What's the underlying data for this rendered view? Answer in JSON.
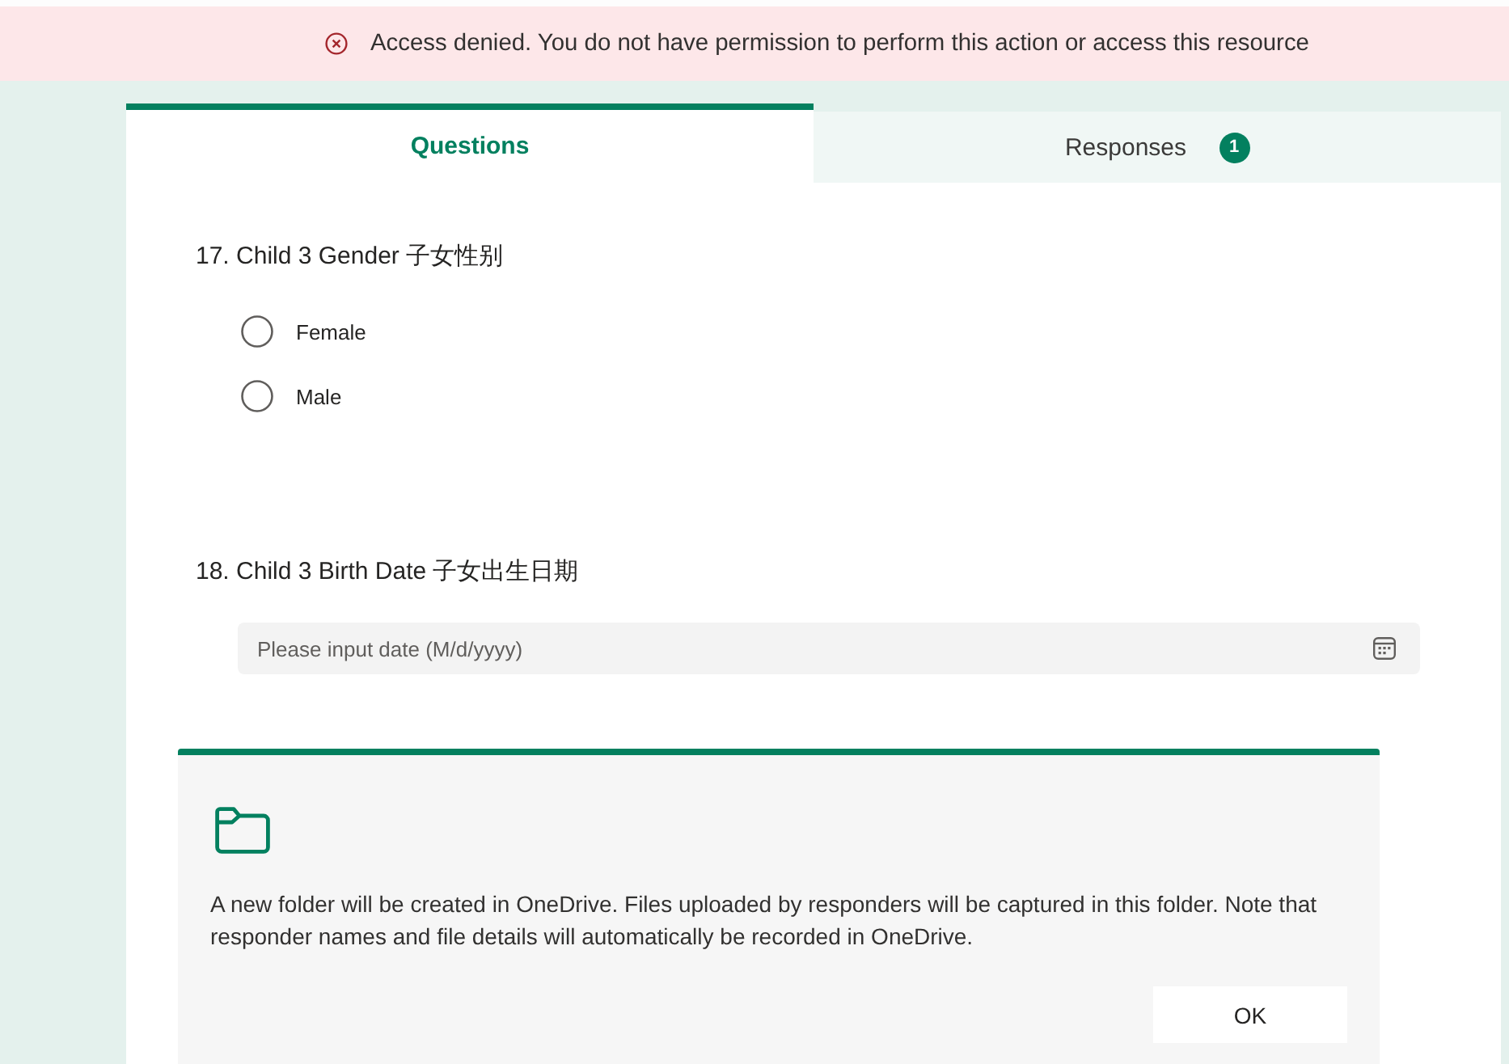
{
  "banner": {
    "message": "Access denied. You do not have permission to perform this action or access this resource"
  },
  "tabs": [
    {
      "label": "Questions",
      "selected": true
    },
    {
      "label": "Responses",
      "selected": false,
      "badge": "1"
    }
  ],
  "questions": [
    {
      "kind": "choice",
      "title": "17. Child 3 Gender 子女性别",
      "options": [
        {
          "label": "Female",
          "selected": false
        },
        {
          "label": "Male",
          "selected": false
        }
      ]
    },
    {
      "kind": "date",
      "title": "18. Child 3 Birth Date 子女出生日期",
      "placeholder": "Please input date (M/d/yyyy)"
    }
  ],
  "upload_dialog": {
    "message": "A new folder will be created in OneDrive. Files uploaded by responders will be captured in this folder. Note that responder names and file details will automatically be recorded in OneDrive.",
    "button": "OK"
  }
}
